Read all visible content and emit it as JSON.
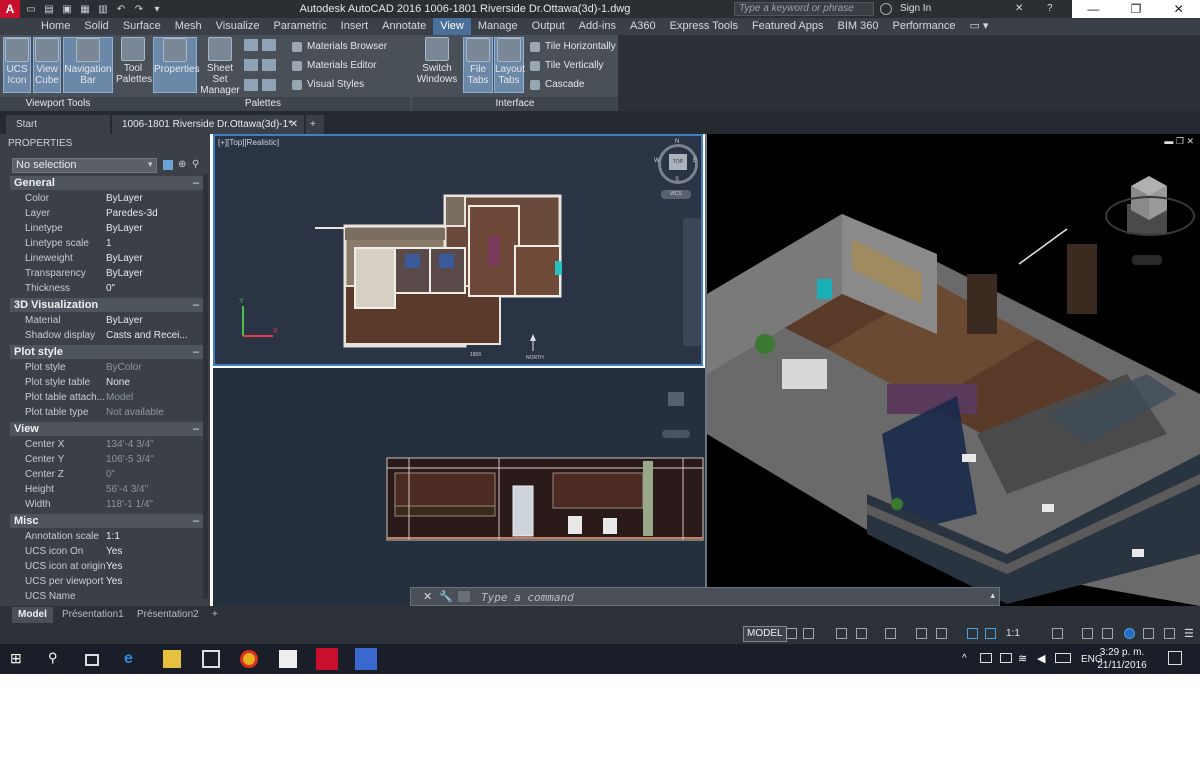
{
  "titlebar": {
    "app_title": "Autodesk AutoCAD 2016    1006-1801 Riverside Dr.Ottawa(3d)-1.dwg",
    "search_placeholder": "Type a keyword or phrase",
    "signin_label": "Sign In"
  },
  "ribbon_tabs": [
    "Home",
    "Solid",
    "Surface",
    "Mesh",
    "Visualize",
    "Parametric",
    "Insert",
    "Annotate",
    "View",
    "Manage",
    "Output",
    "Add-ins",
    "A360",
    "Express Tools",
    "Featured Apps",
    "BIM 360",
    "Performance"
  ],
  "ribbon_active_tab": "View",
  "ribbon": {
    "viewport_tools": {
      "label": "Viewport Tools",
      "buttons": [
        "UCS Icon",
        "View Cube",
        "Navigation Bar"
      ]
    },
    "palettes": {
      "label": "Palettes",
      "buttons": [
        "Tool Palettes",
        "Properties",
        "Sheet Set Manager"
      ],
      "small": [
        "Materials Browser",
        "Materials Editor",
        "Visual Styles"
      ]
    },
    "interface": {
      "label": "Interface",
      "buttons": [
        "Switch Windows",
        "File Tabs",
        "Layout Tabs"
      ],
      "small": [
        "Tile Horizontally",
        "Tile Vertically",
        "Cascade"
      ]
    }
  },
  "doc_tabs": [
    "Start",
    "1006-1801 Riverside Dr.Ottawa(3d)-1*"
  ],
  "properties": {
    "title": "PROPERTIES",
    "selection": "No selection",
    "sections": [
      {
        "name": "General",
        "rows": [
          {
            "k": "Color",
            "v": "ByLayer"
          },
          {
            "k": "Layer",
            "v": "Paredes-3d"
          },
          {
            "k": "Linetype",
            "v": "ByLayer"
          },
          {
            "k": "Linetype scale",
            "v": "1"
          },
          {
            "k": "Lineweight",
            "v": "ByLayer"
          },
          {
            "k": "Transparency",
            "v": "ByLayer"
          },
          {
            "k": "Thickness",
            "v": "0\""
          }
        ]
      },
      {
        "name": "3D Visualization",
        "rows": [
          {
            "k": "Material",
            "v": "ByLayer"
          },
          {
            "k": "Shadow display",
            "v": "Casts  and  Recei..."
          }
        ]
      },
      {
        "name": "Plot style",
        "rows": [
          {
            "k": "Plot style",
            "v": "ByColor"
          },
          {
            "k": "Plot style table",
            "v": "None"
          },
          {
            "k": "Plot table attach...",
            "v": "Model"
          },
          {
            "k": "Plot table type",
            "v": "Not available"
          }
        ]
      },
      {
        "name": "View",
        "rows": [
          {
            "k": "Center X",
            "v": "134'-4 3/4\""
          },
          {
            "k": "Center Y",
            "v": "106'-5 3/4\""
          },
          {
            "k": "Center Z",
            "v": "0\""
          },
          {
            "k": "Height",
            "v": "56'-4 3/4\""
          },
          {
            "k": "Width",
            "v": "118'-1 1/4\""
          }
        ]
      },
      {
        "name": "Misc",
        "rows": [
          {
            "k": "Annotation scale",
            "v": "1:1"
          },
          {
            "k": "UCS icon On",
            "v": "Yes"
          },
          {
            "k": "UCS icon at origin",
            "v": "Yes"
          },
          {
            "k": "UCS per viewport",
            "v": "Yes"
          },
          {
            "k": "UCS Name",
            "v": ""
          }
        ]
      }
    ]
  },
  "viewport_top": {
    "label": "[+][Top][Realistic]",
    "compass": {
      "n": "N",
      "s": "S",
      "e": "E",
      "w": "W",
      "top": "TOP"
    },
    "wcs": "WCS",
    "north_label": "NORTH",
    "unit_label": "1806"
  },
  "command_line": {
    "placeholder": "Type a command"
  },
  "layout_tabs": [
    "Model",
    "Présentation1",
    "Présentation2"
  ],
  "status": {
    "model_label": "MODEL",
    "scale": "1:1"
  },
  "taskbar": {
    "lang": "ENG",
    "time": "3:29 p. m.",
    "date": "21/11/2016"
  }
}
